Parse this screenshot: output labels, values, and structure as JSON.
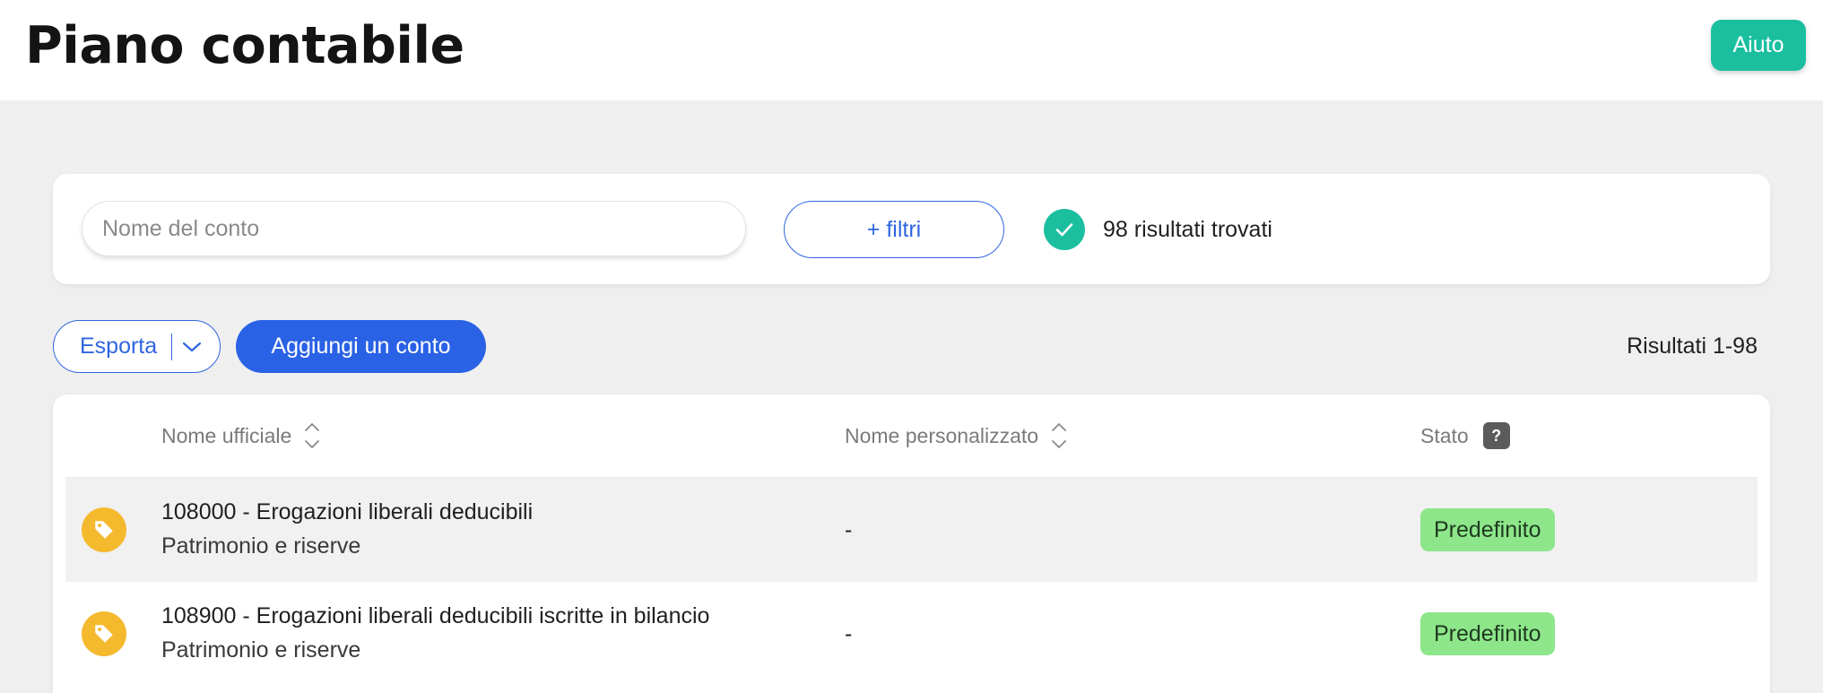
{
  "header": {
    "title": "Piano contabile",
    "help_label": "Aiuto"
  },
  "filters": {
    "search_placeholder": "Nome del conto",
    "filters_label": "+ filtri",
    "results_found": "98 risultati trovati"
  },
  "toolbar": {
    "export_label": "Esporta",
    "add_account_label": "Aggiungi un conto",
    "results_range": "Risultati 1-98"
  },
  "table": {
    "columns": {
      "official_name": "Nome ufficiale",
      "custom_name": "Nome personalizzato",
      "state": "Stato",
      "state_help": "?"
    },
    "rows": [
      {
        "official_name": "108000 - Erogazioni liberali deducibili",
        "category": "Patrimonio e riserve",
        "custom_name": "-",
        "state": "Predefinito"
      },
      {
        "official_name": "108900 - Erogazioni liberali deducibili iscritte in bilancio",
        "category": "Patrimonio e riserve",
        "custom_name": "-",
        "state": "Predefinito"
      }
    ]
  },
  "colors": {
    "primary_blue": "#2a62e6",
    "teal": "#1bbfa0",
    "tag_yellow": "#f5b92e",
    "status_green": "#8de68a"
  },
  "icons": {
    "check": "check-icon",
    "chevron": "chevron-down-icon",
    "sort": "sort-icon",
    "tag": "tag-icon"
  }
}
